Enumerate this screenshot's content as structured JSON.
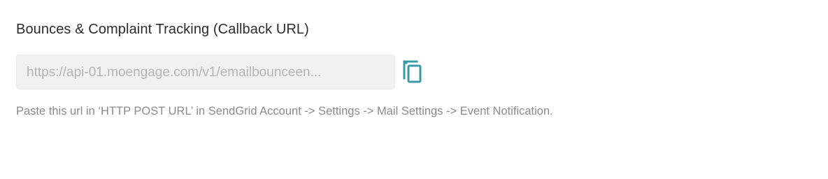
{
  "section": {
    "title": "Bounces & Complaint Tracking (Callback URL)",
    "url_value": "https://api-01.moengage.com/v1/emailbounceen...",
    "help_text": "Paste this url in ‘HTTP POST URL’ in SendGrid Account -> Settings -> Mail Settings -> Event Notification."
  },
  "icons": {
    "copy": "copy-icon"
  },
  "colors": {
    "accent": "#3a9aa8",
    "field_bg": "#f1f1f1",
    "title_text": "#2b2b2b",
    "help_text": "#8a8a8a",
    "field_text": "#b4b4b4"
  }
}
